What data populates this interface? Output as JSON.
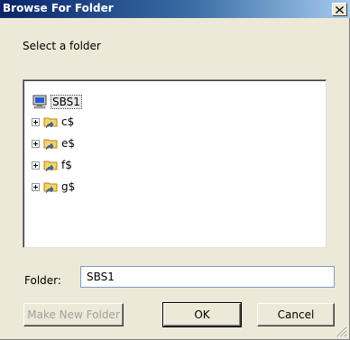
{
  "window": {
    "title": "Browse For Folder",
    "close_label": "×"
  },
  "instructions": "Select a folder",
  "tree": {
    "root": {
      "label": "SBS1",
      "icon": "computer-icon"
    },
    "items": [
      {
        "label": "c$",
        "icon": "shared-folder-icon"
      },
      {
        "label": "e$",
        "icon": "shared-folder-icon"
      },
      {
        "label": "f$",
        "icon": "shared-folder-icon"
      },
      {
        "label": "g$",
        "icon": "shared-folder-icon"
      }
    ]
  },
  "folder": {
    "label": "Folder:",
    "value": "SBS1"
  },
  "buttons": {
    "make_new_folder": "Make New Folder",
    "ok": "OK",
    "cancel": "Cancel"
  },
  "colors": {
    "titlebar_start": "#0a246a",
    "titlebar_end": "#a6caf0",
    "dialog_background": "#ece9d8"
  }
}
